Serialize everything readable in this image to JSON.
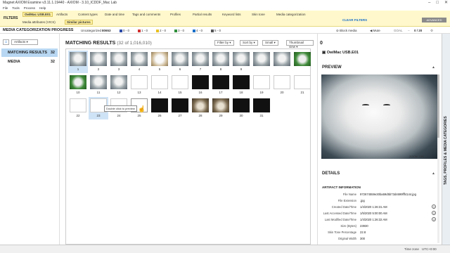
{
  "window": {
    "title": "Magnet AXIOM Examine v3.11.1.19440 - AXIOM - 3.10_ICDDF_Mac Lab"
  },
  "menu": [
    "File",
    "Tools",
    "Process",
    "Help"
  ],
  "filters": {
    "label": "FILTERS",
    "row1": [
      "OwlMac USB.E01",
      "Artifacts",
      "Content types",
      "Date and time",
      "Tags and comments",
      "Profiles",
      "Partial results",
      "Keyword lists",
      "Skin tone",
      "Media categorization"
    ],
    "row2": [
      "Media attributes (VICS)",
      "Similar pictures"
    ],
    "clear": "CLEAR FILTERS",
    "advanced": "ADVANCED"
  },
  "progress": {
    "title": "MEDIA CATEGORIZATION PROGRESS",
    "uncategorized_label": "Uncategorized",
    "uncategorized_count": "80653",
    "tags": [
      {
        "label": "0 - 0",
        "color": "#2b4aa8"
      },
      {
        "label": "1 - 0",
        "color": "#d23030"
      },
      {
        "label": "2 - 0",
        "color": "#e8c020"
      },
      {
        "label": "3 - 0",
        "color": "#2f8f3a"
      },
      {
        "label": "4 - 0",
        "color": "#1a6fc9"
      },
      {
        "label": "5 - 0",
        "color": "#555555"
      }
    ],
    "block_media": "Block media",
    "mute": "Mute",
    "goal": "GOAL",
    "goal_value": "0 / 20"
  },
  "left": {
    "artifacts_btn": "Artifacts",
    "rows": [
      {
        "label": "MATCHING RESULTS",
        "count": "32"
      },
      {
        "label": "MEDIA",
        "count": "32"
      }
    ]
  },
  "center": {
    "title": "MATCHING RESULTS",
    "subtitle": "(32 of 1,016,010)",
    "filter_by": "Filter by",
    "sort_by": "Sort by",
    "size": "Small",
    "view": "Thumbnail view",
    "tooltip": "Double click to preview",
    "cells": [
      {
        "num": "1",
        "kind": "owl"
      },
      {
        "num": "2",
        "kind": "owl"
      },
      {
        "num": "3",
        "kind": "owl"
      },
      {
        "num": "4",
        "kind": "owl"
      },
      {
        "num": "5",
        "kind": "bright"
      },
      {
        "num": "6",
        "kind": "owl"
      },
      {
        "num": "7",
        "kind": "owl"
      },
      {
        "num": "8",
        "kind": "owl"
      },
      {
        "num": "9",
        "kind": "owl"
      },
      {
        "num": "",
        "kind": "owl"
      },
      {
        "num": "",
        "kind": "owl"
      },
      {
        "num": "",
        "kind": "green"
      },
      {
        "num": "10",
        "kind": "green"
      },
      {
        "num": "11",
        "kind": "owl"
      },
      {
        "num": "12",
        "kind": "owl"
      },
      {
        "num": "13",
        "kind": "white"
      },
      {
        "num": "14",
        "kind": "white"
      },
      {
        "num": "15",
        "kind": "white"
      },
      {
        "num": "16",
        "kind": "dark"
      },
      {
        "num": "17",
        "kind": "dark"
      },
      {
        "num": "18",
        "kind": "dark"
      },
      {
        "num": "19",
        "kind": "white"
      },
      {
        "num": "20",
        "kind": "white"
      },
      {
        "num": "21",
        "kind": "white"
      },
      {
        "num": "22",
        "kind": "white"
      },
      {
        "num": "23",
        "kind": "white"
      },
      {
        "num": "24",
        "kind": "white"
      },
      {
        "num": "25",
        "kind": "doc"
      },
      {
        "num": "26",
        "kind": "dark"
      },
      {
        "num": "27",
        "kind": "dark"
      },
      {
        "num": "28",
        "kind": "eggs"
      },
      {
        "num": "29",
        "kind": "eggs"
      },
      {
        "num": "30",
        "kind": "dark"
      },
      {
        "num": "31",
        "kind": "dark"
      }
    ]
  },
  "right": {
    "count": "0",
    "item_title": "OwlMac USB.E01",
    "preview_label": "PREVIEW",
    "zoom": "ZOOM 73%",
    "details_label": "DETAILS",
    "artifact_info": "ARTIFACT INFORMATION",
    "meta": [
      {
        "k": "File Name",
        "v": "972674559e30ba59d5b73d4699fff4144.jpg"
      },
      {
        "k": "File Extension",
        "v": ".jpg"
      },
      {
        "k": "Created Date/Time",
        "v": "1/4/2020 1:26:31 AM"
      },
      {
        "k": "Last Accessed Date/Time",
        "v": "1/5/2020 5:00:00 AM"
      },
      {
        "k": "Last Modified Date/Time",
        "v": "1/4/2020 1:26:32 AM"
      },
      {
        "k": "Size (Bytes)",
        "v": "23930"
      },
      {
        "k": "Skin Tone Percentage",
        "v": "22.8"
      },
      {
        "k": "Original Width",
        "v": "300"
      }
    ],
    "vtab": "TAGS, PROFILES & MEDIA CATEGORIES"
  },
  "status": {
    "time_zone": "Time zone",
    "utc": "UTC+0:00"
  }
}
